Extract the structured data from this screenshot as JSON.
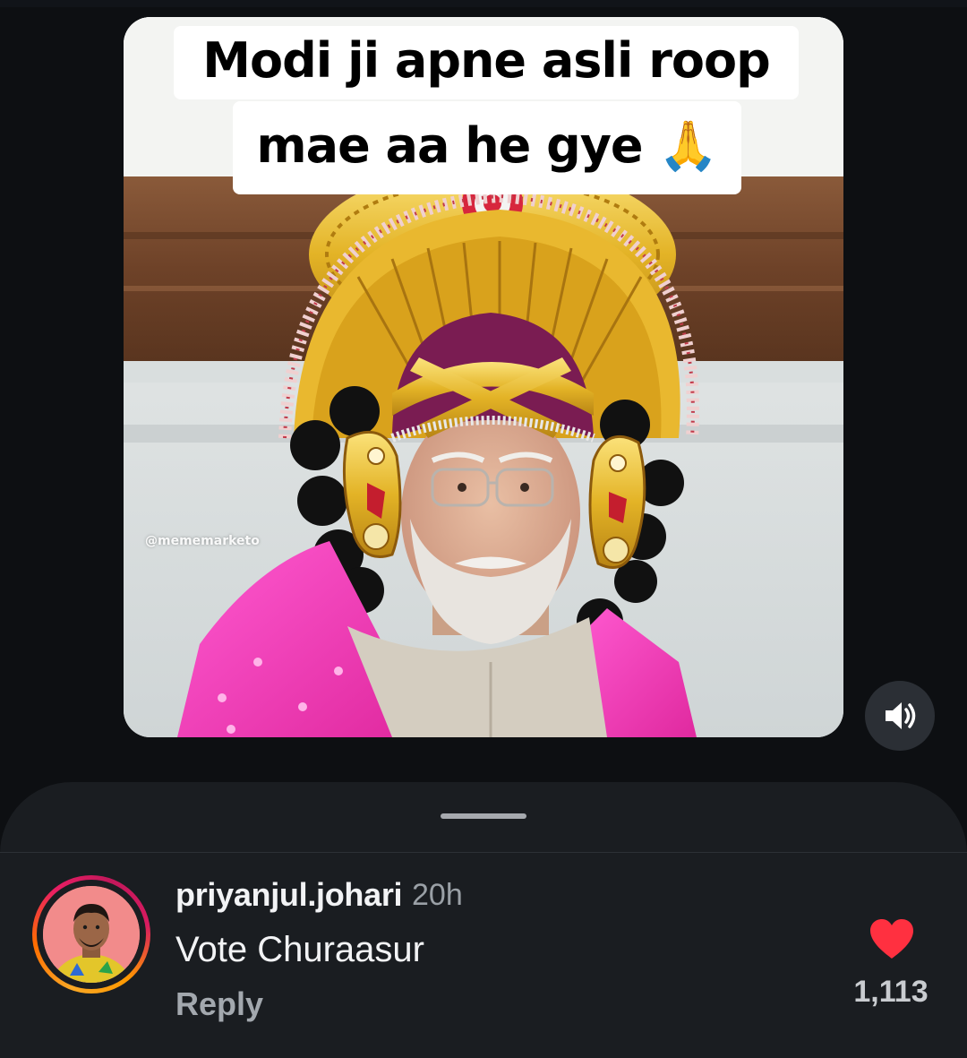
{
  "post": {
    "caption_line1": "Modi ji apne asli roop",
    "caption_line2": "mae aa he gye 🙏",
    "watermark": "@mememarketo"
  },
  "controls": {
    "volume_icon": "speaker-volume-icon"
  },
  "comment": {
    "username": "priyanjul.johari",
    "timestamp": "20h",
    "text": "Vote Churaasur",
    "reply_label": "Reply",
    "like_count": "1,113",
    "like_icon": "heart-icon"
  },
  "colors": {
    "background": "#0d0f12",
    "sheet": "#1a1d21",
    "like_red": "#ff3040",
    "story_ring": [
      "#f9a825",
      "#e91e63"
    ]
  }
}
